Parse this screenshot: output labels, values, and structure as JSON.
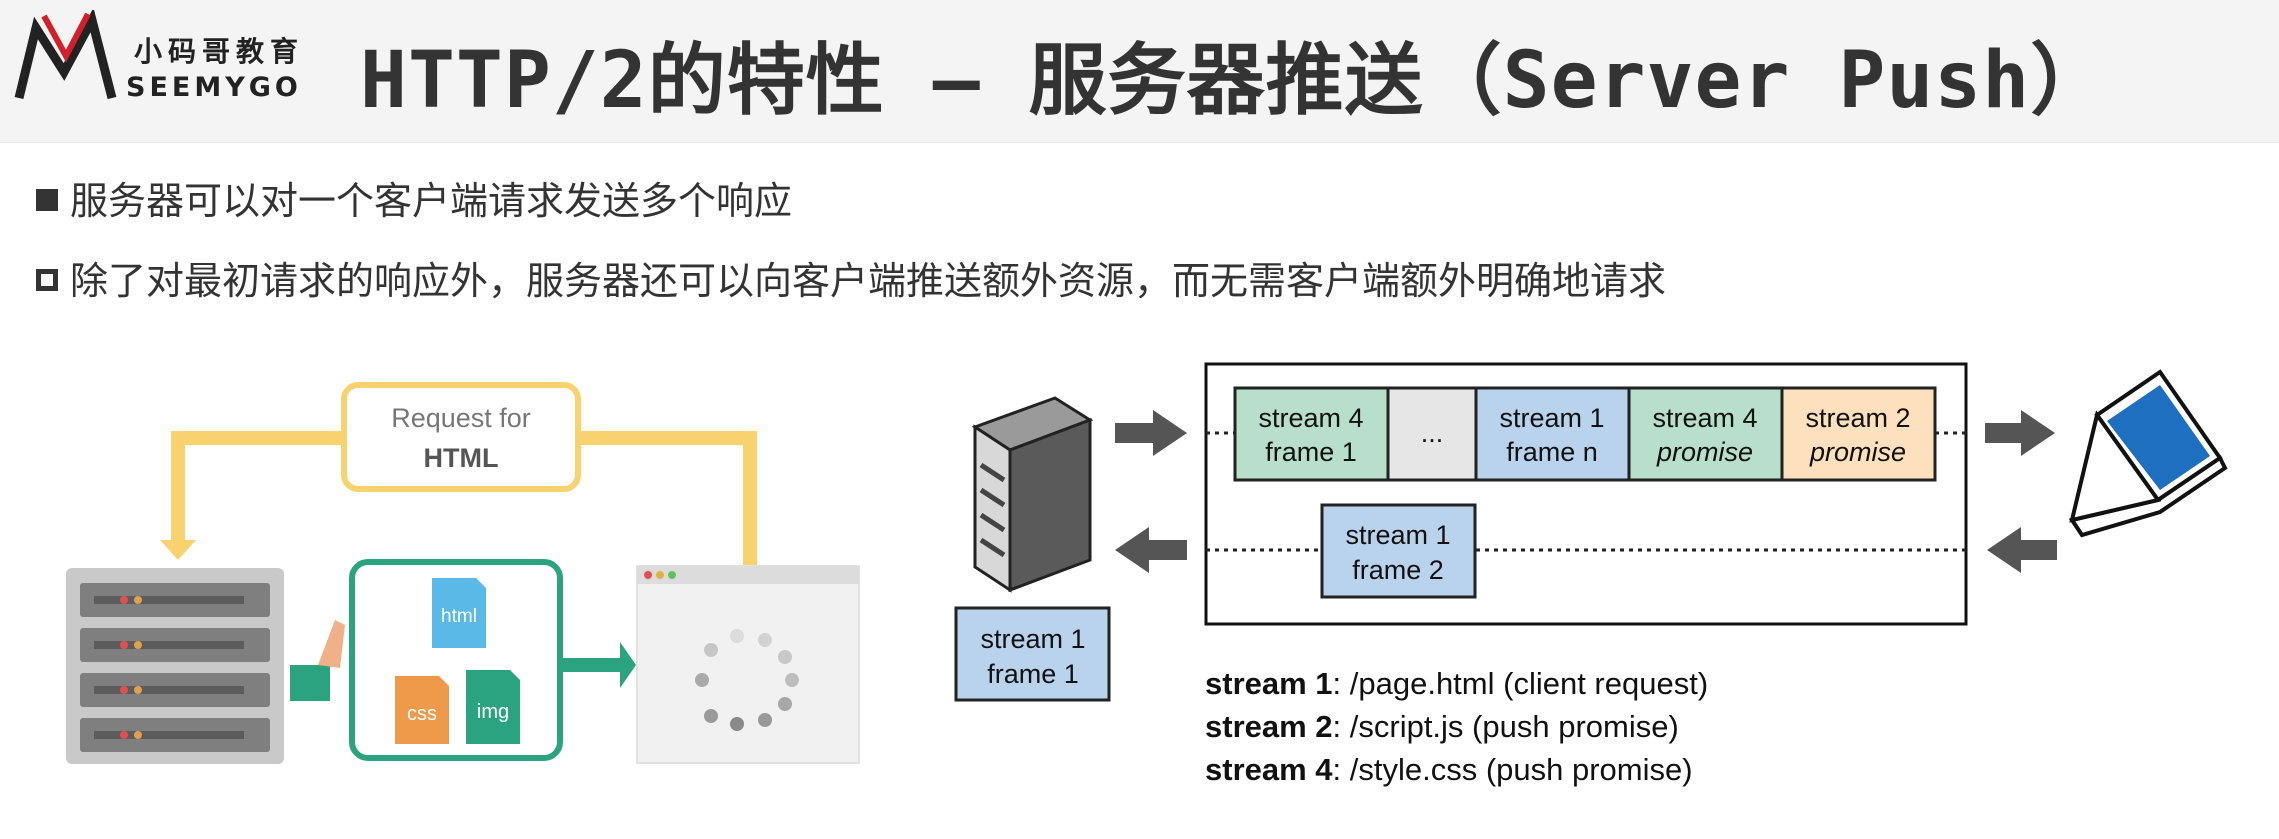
{
  "header": {
    "logo_cn": "小码哥教育",
    "logo_en": "SEEMYGO",
    "title": "HTTP/2的特性 – 服务器推送（Server Push）"
  },
  "bullets": [
    {
      "style": "filled",
      "text": "服务器可以对一个客户端请求发送多个响应"
    },
    {
      "style": "hollow",
      "text": "除了对最初请求的响应外，服务器还可以向客户端推送额外资源，而无需客户端额外明确地请求"
    }
  ],
  "left_diagram": {
    "request_line1": "Request for",
    "request_line2": "HTML",
    "file_html": "html",
    "file_css": "css",
    "file_img": "img"
  },
  "right_diagram": {
    "top_frames": [
      {
        "line1": "stream 4",
        "line2": "frame 1",
        "color": "#b8dfcb",
        "italic": false
      },
      {
        "line1": "...",
        "line2": "",
        "color": "#e6e6e6",
        "italic": false
      },
      {
        "line1": "stream 1",
        "line2": "frame n",
        "color": "#b9d3ec",
        "italic": false
      },
      {
        "line1": "stream 4",
        "line2": "promise",
        "color": "#b8dfcb",
        "italic": true
      },
      {
        "line1": "stream 2",
        "line2": "promise",
        "color": "#fde0bd",
        "italic": true
      }
    ],
    "bottom_frame": {
      "line1": "stream 1",
      "line2": "frame 2"
    },
    "server_frame": {
      "line1": "stream 1",
      "line2": "frame 1"
    }
  },
  "legend": [
    {
      "label": "stream 1",
      "desc": ": /page.html  (client request)"
    },
    {
      "label": "stream 2",
      "desc": ": /script.js  (push promise)"
    },
    {
      "label": "stream 4",
      "desc": ": /style.css  (push promise)"
    }
  ]
}
